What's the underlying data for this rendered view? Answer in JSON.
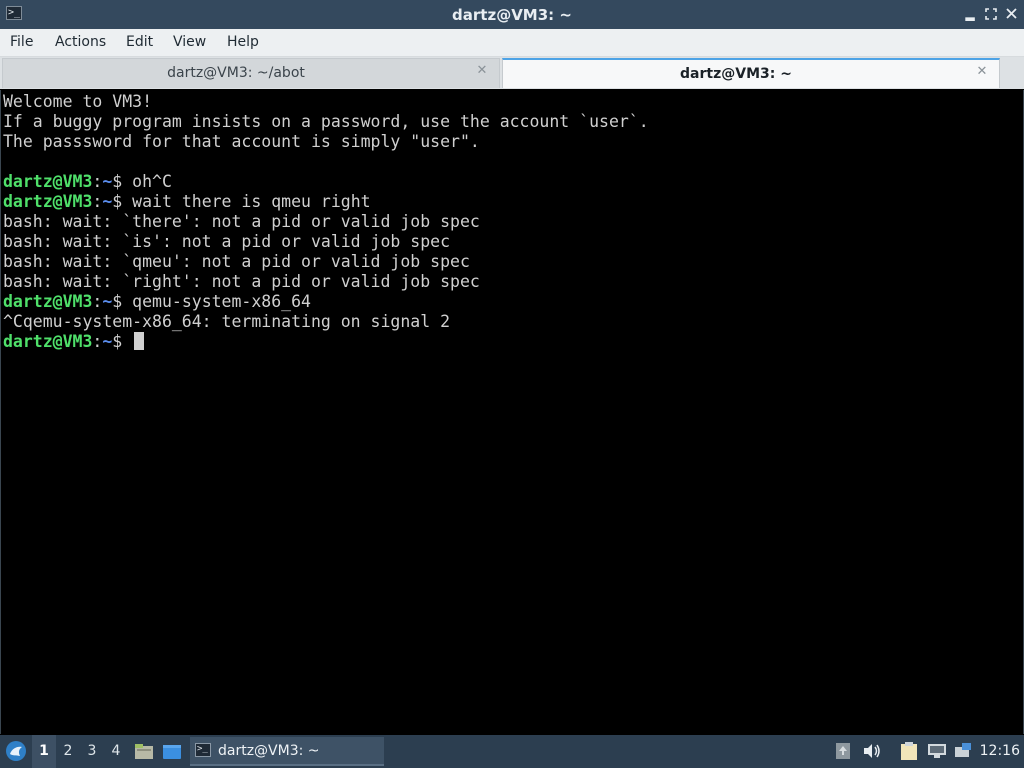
{
  "window": {
    "title": "dartz@VM3: ~",
    "icon": "terminal-icon",
    "buttons": [
      "minimize-icon",
      "maximize-icon",
      "close-icon"
    ]
  },
  "menu": {
    "items": [
      "File",
      "Actions",
      "Edit",
      "View",
      "Help"
    ]
  },
  "tabs": [
    {
      "label": "dartz@VM3: ~/abot",
      "active": false
    },
    {
      "label": "dartz@VM3: ~",
      "active": true
    }
  ],
  "terminal": {
    "colors": {
      "user": "#4fe06a",
      "path": "#5c8ff0",
      "text": "#d0d0d0",
      "background": "#000000"
    },
    "lines": [
      {
        "type": "text",
        "text": "Welcome to VM3!"
      },
      {
        "type": "text",
        "text": "If a buggy program insists on a password, use the account `user`."
      },
      {
        "type": "text",
        "text": "The passsword for that account is simply \"user\"."
      },
      {
        "type": "text",
        "text": ""
      },
      {
        "type": "prompt",
        "user": "dartz@VM3",
        "path": "~",
        "cmd": "oh^C"
      },
      {
        "type": "prompt",
        "user": "dartz@VM3",
        "path": "~",
        "cmd": "wait there is qmeu right"
      },
      {
        "type": "text",
        "text": "bash: wait: `there': not a pid or valid job spec"
      },
      {
        "type": "text",
        "text": "bash: wait: `is': not a pid or valid job spec"
      },
      {
        "type": "text",
        "text": "bash: wait: `qmeu': not a pid or valid job spec"
      },
      {
        "type": "text",
        "text": "bash: wait: `right': not a pid or valid job spec"
      },
      {
        "type": "prompt",
        "user": "dartz@VM3",
        "path": "~",
        "cmd": "qemu-system-x86_64"
      },
      {
        "type": "text",
        "text": "^Cqemu-system-x86_64: terminating on signal 2"
      },
      {
        "type": "prompt",
        "user": "dartz@VM3",
        "path": "~",
        "cmd": "",
        "cursor": true
      }
    ]
  },
  "taskbar": {
    "start_icon": "lxqt-start-icon",
    "desktops": [
      "1",
      "2",
      "3",
      "4"
    ],
    "active_desktop": "1",
    "launchers": [
      "file-manager-icon",
      "show-desktop-icon"
    ],
    "task": {
      "label": "dartz@VM3: ~",
      "icon": "terminal-icon"
    },
    "tray": [
      "upload-icon",
      "volume-icon",
      "clipboard-icon",
      "network-icon",
      "notification-icon"
    ],
    "clock": "12:16"
  }
}
